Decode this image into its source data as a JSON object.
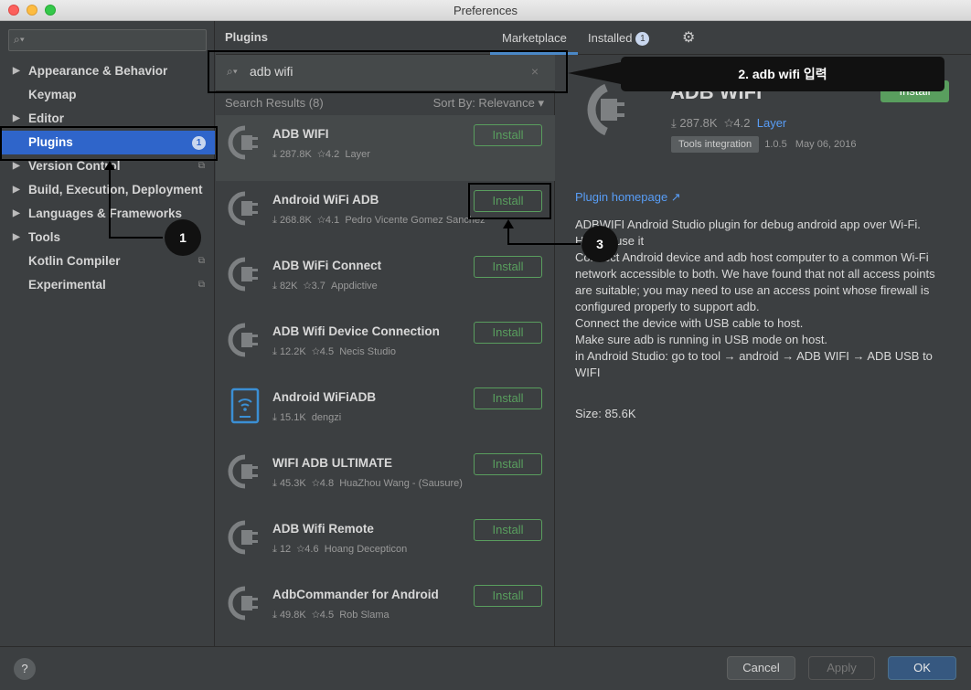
{
  "window": {
    "title": "Preferences"
  },
  "sidebar": {
    "search_placeholder": "",
    "items": [
      {
        "label": "Appearance & Behavior",
        "arrow": "▶",
        "badge": "",
        "copy": false
      },
      {
        "label": "Keymap",
        "arrow": "",
        "badge": "",
        "copy": false
      },
      {
        "label": "Editor",
        "arrow": "▶",
        "badge": "",
        "copy": false
      },
      {
        "label": "Plugins",
        "arrow": "",
        "badge": "1",
        "copy": false,
        "selected": true
      },
      {
        "label": "Version Control",
        "arrow": "▶",
        "badge": "",
        "copy": true
      },
      {
        "label": "Build, Execution, Deployment",
        "arrow": "▶",
        "badge": "",
        "copy": false
      },
      {
        "label": "Languages & Frameworks",
        "arrow": "▶",
        "badge": "",
        "copy": false
      },
      {
        "label": "Tools",
        "arrow": "▶",
        "badge": "",
        "copy": false
      },
      {
        "label": "Kotlin Compiler",
        "arrow": "",
        "badge": "",
        "copy": true
      },
      {
        "label": "Experimental",
        "arrow": "",
        "badge": "",
        "copy": true
      }
    ]
  },
  "header": {
    "title": "Plugins",
    "tab_marketplace": "Marketplace",
    "tab_installed": "Installed",
    "installed_count": "1"
  },
  "search": {
    "value": "adb wifi"
  },
  "results": {
    "count_label": "Search Results (8)",
    "sort_label": "Sort By: Relevance ▾",
    "install_label": "Install",
    "items": [
      {
        "name": "ADB WIFI",
        "downloads": "287.8K",
        "rating": "4.2",
        "vendor": "Layer"
      },
      {
        "name": "Android WiFi ADB",
        "downloads": "268.8K",
        "rating": "4.1",
        "vendor": "Pedro Vicente Gomez Sanchez"
      },
      {
        "name": "ADB WiFi Connect",
        "downloads": "82K",
        "rating": "3.7",
        "vendor": "Appdictive"
      },
      {
        "name": "ADB Wifi Device Connection",
        "downloads": "12.2K",
        "rating": "4.5",
        "vendor": "Necis Studio"
      },
      {
        "name": "Android WiFiADB",
        "downloads": "15.1K",
        "rating": "",
        "vendor": "dengzi"
      },
      {
        "name": "WIFI ADB ULTIMATE",
        "downloads": "45.3K",
        "rating": "4.8",
        "vendor": "HuaZhou Wang - (Sausure)"
      },
      {
        "name": "ADB Wifi Remote",
        "downloads": "12",
        "rating": "4.6",
        "vendor": "Hoang Decepticon"
      },
      {
        "name": "AdbCommander for Android",
        "downloads": "49.8K",
        "rating": "4.5",
        "vendor": "Rob Slama"
      }
    ]
  },
  "detail": {
    "title": "ADB WIFI",
    "install_label": "Install",
    "downloads": "287.8K",
    "rating": "4.2",
    "vendor": "Layer",
    "tag": "Tools integration",
    "version": "1.0.5",
    "date": "May 06, 2016",
    "homepage": "Plugin homepage ↗",
    "desc": [
      "ADBWIFI Android Studio plugin for debug android app over Wi-Fi.",
      "How to use it",
      "Connect Android device and adb host computer to a common Wi-Fi network accessible to both. We have found that not all access points are suitable; you may need to use an access point whose firewall is configured properly to support adb.",
      "Connect the device with USB cable to host.",
      "Make sure adb is running in USB mode on host.",
      "in Android Studio: go to tool → android → ADB WIFI → ADB USB to WIFI"
    ],
    "size": "Size: 85.6K"
  },
  "buttons": {
    "cancel": "Cancel",
    "apply": "Apply",
    "ok": "OK",
    "help": "?"
  },
  "annotations": {
    "callout": "2. adb wifi 입력",
    "step1": "1",
    "step3": "3"
  },
  "colors": {
    "accent": "#2f65ca",
    "install_green": "#599e5e",
    "link": "#589df6"
  }
}
